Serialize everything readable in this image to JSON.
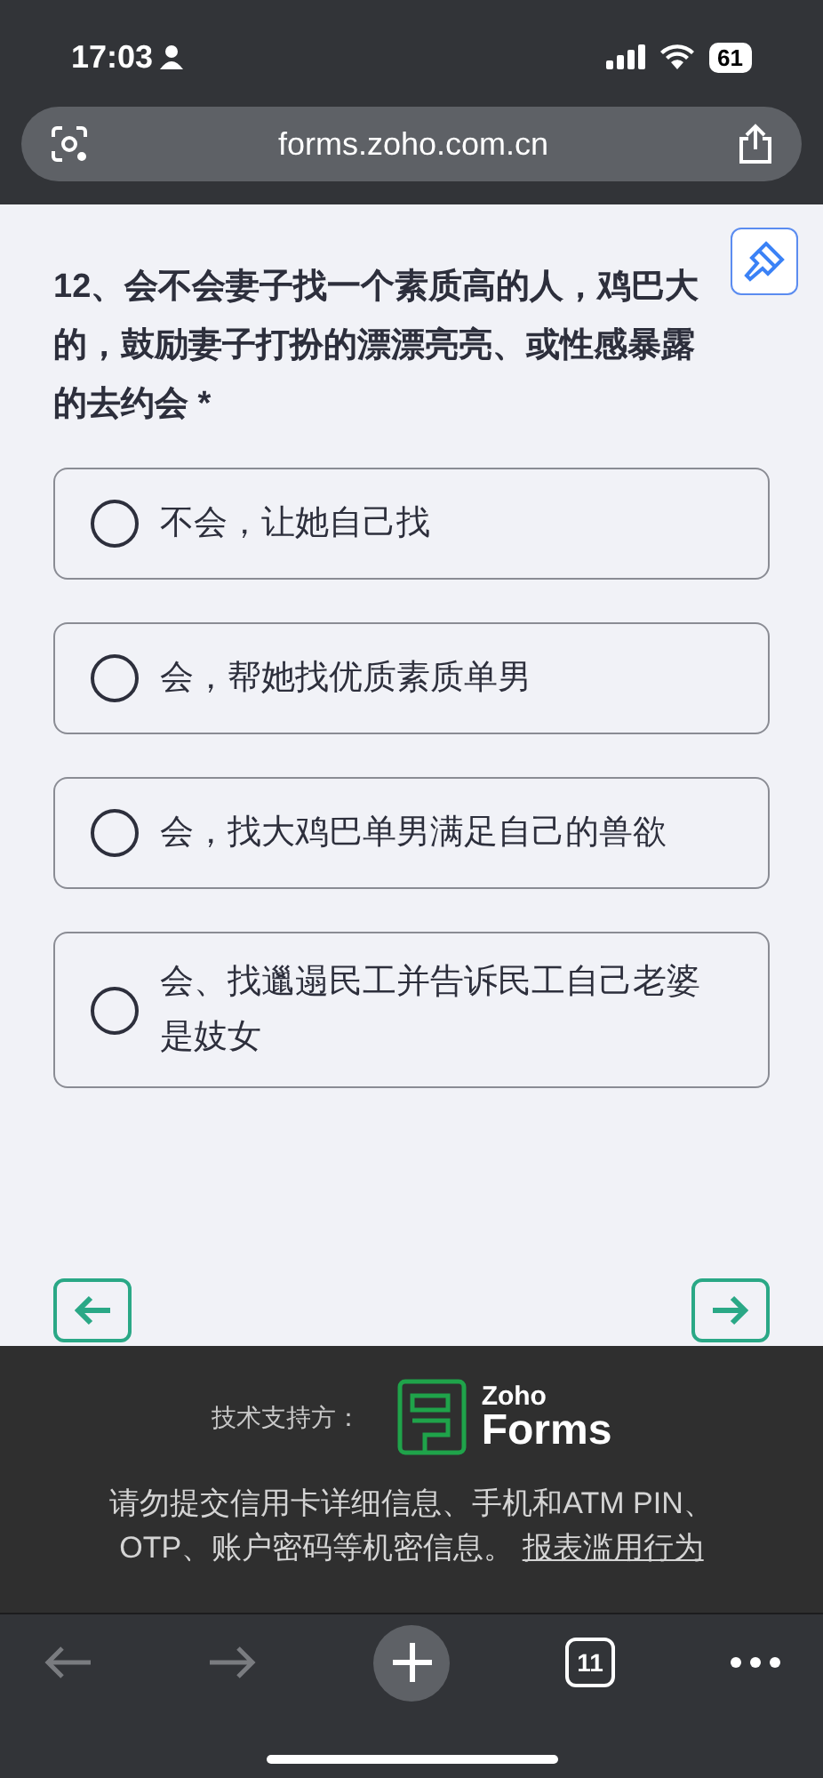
{
  "status_bar": {
    "time": "17:03",
    "battery": "61"
  },
  "address_bar": {
    "url": "forms.zoho.com.cn"
  },
  "question": {
    "title": "12、会不会妻子找一个素质高的人，鸡巴大的，鼓励妻子打扮的漂漂亮亮、或性感暴露的去约会",
    "required_mark": "*"
  },
  "options": [
    {
      "label": "不会，让她自己找",
      "selected": false
    },
    {
      "label": "会，帮她找优质素质单男",
      "selected": false
    },
    {
      "label": "会，找大鸡巴单男满足自己的兽欲",
      "selected": false
    },
    {
      "label": "会、找邋遢民工并告诉民工自己老婆是妓女",
      "selected": false
    }
  ],
  "footer": {
    "powered_by": "技术支持方：",
    "logo_small": "Zoho",
    "logo_large": "Forms",
    "notice": "请勿提交信用卡详细信息、手机和ATM PIN、OTP、账户密码等机密信息。",
    "report_link": "报表滥用行为"
  },
  "toolbar": {
    "tab_count": "11"
  }
}
